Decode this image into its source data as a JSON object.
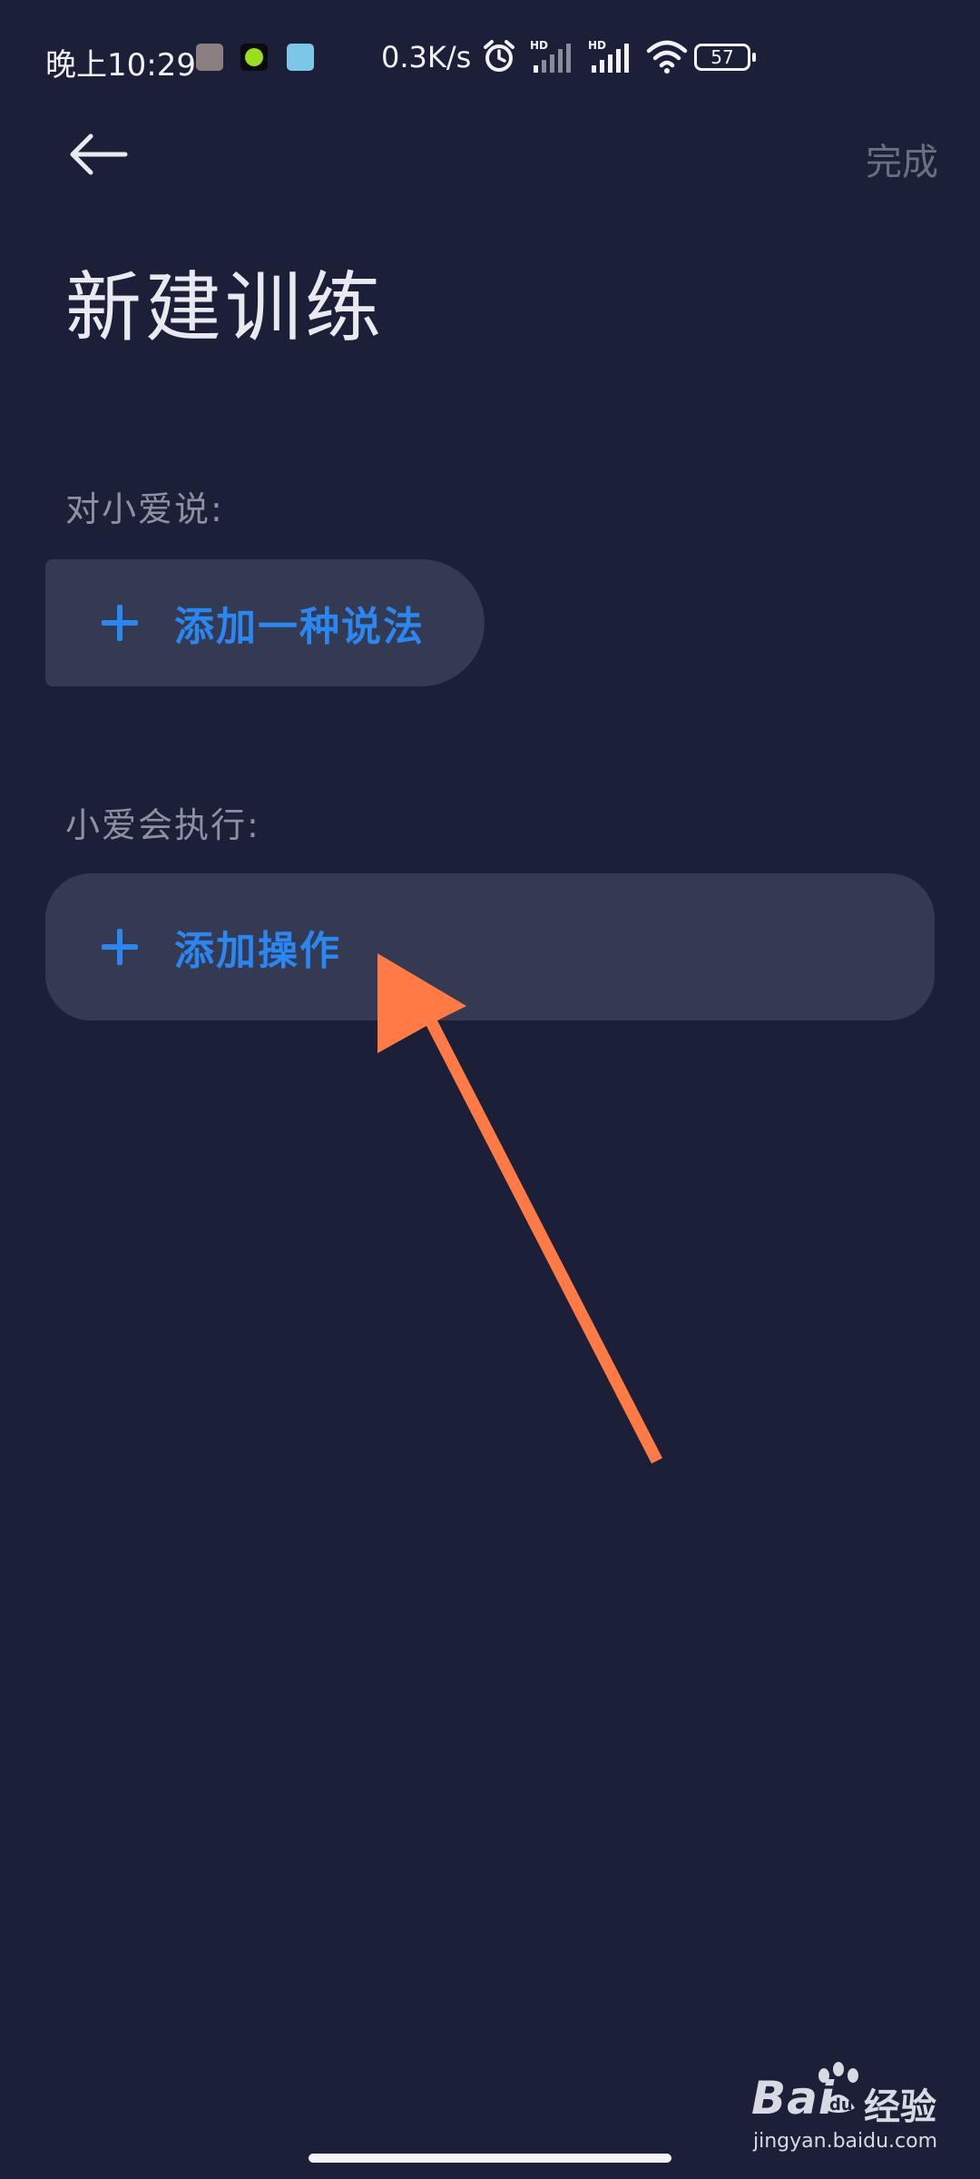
{
  "status_bar": {
    "time": "晚上10:29",
    "net_speed": "0.3K/s",
    "battery": "57",
    "signal_1_label": "HD",
    "signal_2_label": "HD"
  },
  "header": {
    "done_label": "完成",
    "title": "新建训练"
  },
  "say_section": {
    "label": "对小爱说:",
    "add_label": "添加一种说法"
  },
  "execute_section": {
    "label": "小爱会执行:",
    "add_label": "添加操作"
  },
  "watermark": {
    "brand_prefix": "Bai",
    "brand_suffix": "经验",
    "url": "jingyan.baidu.com"
  },
  "colors": {
    "background": "#1b2038",
    "card": "#343a52",
    "accent": "#2a86f0",
    "arrow": "#ff7a45"
  }
}
